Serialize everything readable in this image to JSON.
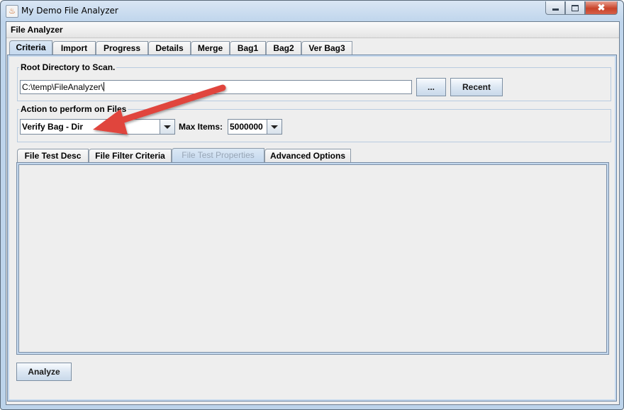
{
  "window": {
    "title": "My Demo File Analyzer",
    "icon": "java-cup-icon",
    "controls": {
      "minimize": "minimize-icon",
      "maximize": "maximize-icon",
      "close": "✖"
    }
  },
  "menubar": {
    "title": "File Analyzer"
  },
  "main_tabs": [
    {
      "label": "Criteria",
      "selected": true
    },
    {
      "label": "Import"
    },
    {
      "label": "Progress"
    },
    {
      "label": "Details"
    },
    {
      "label": "Merge"
    },
    {
      "label": "Bag1"
    },
    {
      "label": "Bag2"
    },
    {
      "label": "Ver Bag3"
    }
  ],
  "root_dir": {
    "group_title": "Root Directory to Scan.",
    "value": "C:\\temp\\FileAnalyzer\\",
    "browse_label": "...",
    "recent_label": "Recent"
  },
  "action": {
    "group_title": "Action to perform on Files",
    "selected": "Verify Bag - Dir",
    "max_items_label": "Max Items:",
    "max_items_value": "5000000"
  },
  "sub_tabs": [
    {
      "label": "File Test Desc"
    },
    {
      "label": "File Filter Criteria"
    },
    {
      "label": "File Test Properties",
      "selected": true,
      "disabled": true
    },
    {
      "label": "Advanced Options"
    }
  ],
  "analyze_label": "Analyze",
  "annotation": {
    "type": "arrow",
    "color": "#e0403c",
    "points_to": "action-combo"
  }
}
